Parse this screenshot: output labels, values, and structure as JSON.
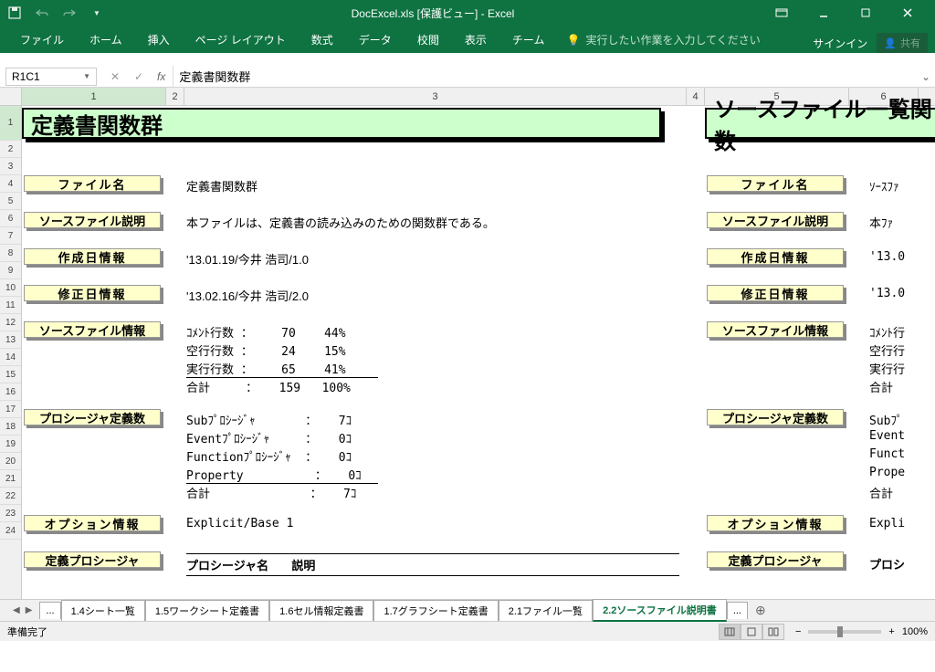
{
  "title": "DocExcel.xls [保護ビュー] - Excel",
  "ribbon": {
    "tabs": [
      "ファイル",
      "ホーム",
      "挿入",
      "ページ レイアウト",
      "数式",
      "データ",
      "校閲",
      "表示",
      "チーム"
    ],
    "tell": "実行したい作業を入力してください",
    "signin": "サインイン",
    "share": "共有"
  },
  "formula_bar": {
    "name_box": "R1C1",
    "formula": "定義書関数群"
  },
  "columns": [
    "1",
    "2",
    "3",
    "4",
    "5",
    "6"
  ],
  "rows": [
    "1",
    "2",
    "3",
    "4",
    "5",
    "6",
    "7",
    "8",
    "9",
    "10",
    "11",
    "12",
    "13",
    "14",
    "15",
    "16",
    "17",
    "18",
    "19",
    "20",
    "21",
    "22",
    "23",
    "24"
  ],
  "sheet": {
    "header1": "定義書関数群",
    "header2": "ソースファイル一覧関数",
    "labels": {
      "file_name": "ファイル名",
      "src_desc": "ソースファイル説明",
      "create_info": "作成日情報",
      "modify_info": "修正日情報",
      "src_info": "ソースファイル情報",
      "proc_def": "プロシージャ定義数",
      "option_info": "オプション情報",
      "def_proc": "定義プロシージャ"
    },
    "values": {
      "file_name": "定義書関数群",
      "src_desc": "本ファイルは、定義書の読み込みのための関数群である。",
      "create_info": "'13.01.19/今井 浩司/1.0",
      "modify_info": "'13.02.16/今井 浩司/2.0",
      "lines": [
        "ｺﾒﾝﾄ行数 ：    70    44%",
        "空行行数 ：    24    15%",
        "実行行数 ：    65    41%",
        "合計     ：   159   100%"
      ],
      "procs": [
        "Subﾌﾟﾛｼｰｼﾞｬ       ：   7ｺ",
        "Eventﾌﾟﾛｼｰｼﾞｬ     ：   0ｺ",
        "Functionﾌﾟﾛｼｰｼﾞｬ  ：   0ｺ",
        "Property          ：   0ｺ",
        "合計              ：   7ｺ"
      ],
      "option": "Explicit/Base 1",
      "proc_header": "プロシージャ名       説明"
    },
    "right": {
      "file_name": "ｿｰｽﾌｧ",
      "src_desc": "本ﾌｧ",
      "create_info": "'13.0",
      "modify_info": "'13.0",
      "lines": [
        "ｺﾒﾝﾄ行",
        "空行行",
        "実行行",
        "合計"
      ],
      "procs": [
        "Subﾌﾟ",
        "Event",
        "Funct",
        "Prope",
        "合計"
      ],
      "option": "Expli",
      "proc_header": "プロシ"
    }
  },
  "tabs": {
    "items": [
      "1.4シート一覧",
      "1.5ワークシート定義書",
      "1.6セル情報定義書",
      "1.7グラフシート定義書",
      "2.1ファイル一覧",
      "2.2ソースファイル説明書"
    ],
    "active": 5
  },
  "status": {
    "ready": "準備完了",
    "zoom": "100%"
  }
}
